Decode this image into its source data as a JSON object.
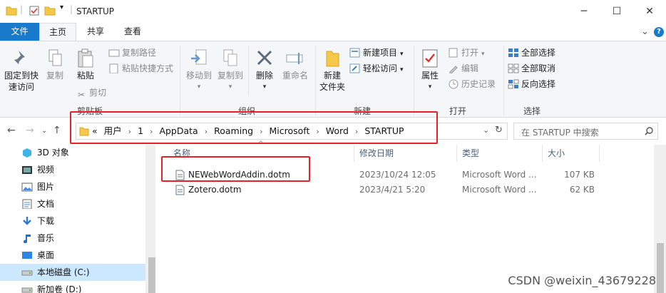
{
  "window": {
    "title": "STARTUP",
    "minimize": "─",
    "maximize": "☐",
    "close": "✕"
  },
  "tabs": {
    "file": "文件",
    "home": "主页",
    "share": "共享",
    "view": "查看",
    "help": "?"
  },
  "ribbon": {
    "clipboard": {
      "pin": "固定到快\n速访问",
      "copy": "复制",
      "paste": "粘贴",
      "copy_path": "复制路径",
      "paste_shortcut": "粘贴快捷方式",
      "cut": "剪切",
      "label": "剪贴板"
    },
    "organize": {
      "move_to": "移动到",
      "copy_to": "复制到",
      "delete": "删除",
      "rename": "重命名",
      "label": "组织"
    },
    "new": {
      "new_folder": "新建\n文件夹",
      "new_item": "新建项目",
      "easy_access": "轻松访问",
      "label": "新建"
    },
    "open": {
      "properties": "属性",
      "open": "打开",
      "edit": "编辑",
      "history": "历史记录",
      "label": "打开"
    },
    "select": {
      "select_all": "全部选择",
      "select_none": "全部取消",
      "invert": "反向选择",
      "label": "选择"
    }
  },
  "address": {
    "crumbs": [
      "«",
      "用户",
      "1",
      "AppData",
      "Roaming",
      "Microsoft",
      "Word",
      "STARTUP"
    ],
    "search_placeholder": "在 STARTUP 中搜索"
  },
  "navpane": {
    "items": [
      {
        "label": "3D 对象",
        "icon": "3d-objects-icon"
      },
      {
        "label": "视频",
        "icon": "video-icon"
      },
      {
        "label": "图片",
        "icon": "pictures-icon"
      },
      {
        "label": "文档",
        "icon": "documents-icon"
      },
      {
        "label": "下载",
        "icon": "download-icon"
      },
      {
        "label": "音乐",
        "icon": "music-icon"
      },
      {
        "label": "桌面",
        "icon": "desktop-icon"
      },
      {
        "label": "本地磁盘 (C:)",
        "icon": "drive-icon"
      },
      {
        "label": "新加卷 (D:)",
        "icon": "drive-icon"
      }
    ]
  },
  "filelist": {
    "columns": {
      "name": "名称",
      "modified": "修改日期",
      "type": "类型",
      "size": "大小"
    },
    "rows": [
      {
        "name": "NEWebWordAddin.dotm",
        "modified": "2023/10/24 12:05",
        "type": "Microsoft Word ...",
        "size": "107 KB"
      },
      {
        "name": "Zotero.dotm",
        "modified": "2023/4/21 5:20",
        "type": "Microsoft Word ...",
        "size": "62 KB"
      }
    ]
  },
  "watermark": "CSDN @weixin_43679228",
  "colors": {
    "accent": "#1979ca",
    "highlight": "#e8202a",
    "selection": "#cce8ff"
  }
}
